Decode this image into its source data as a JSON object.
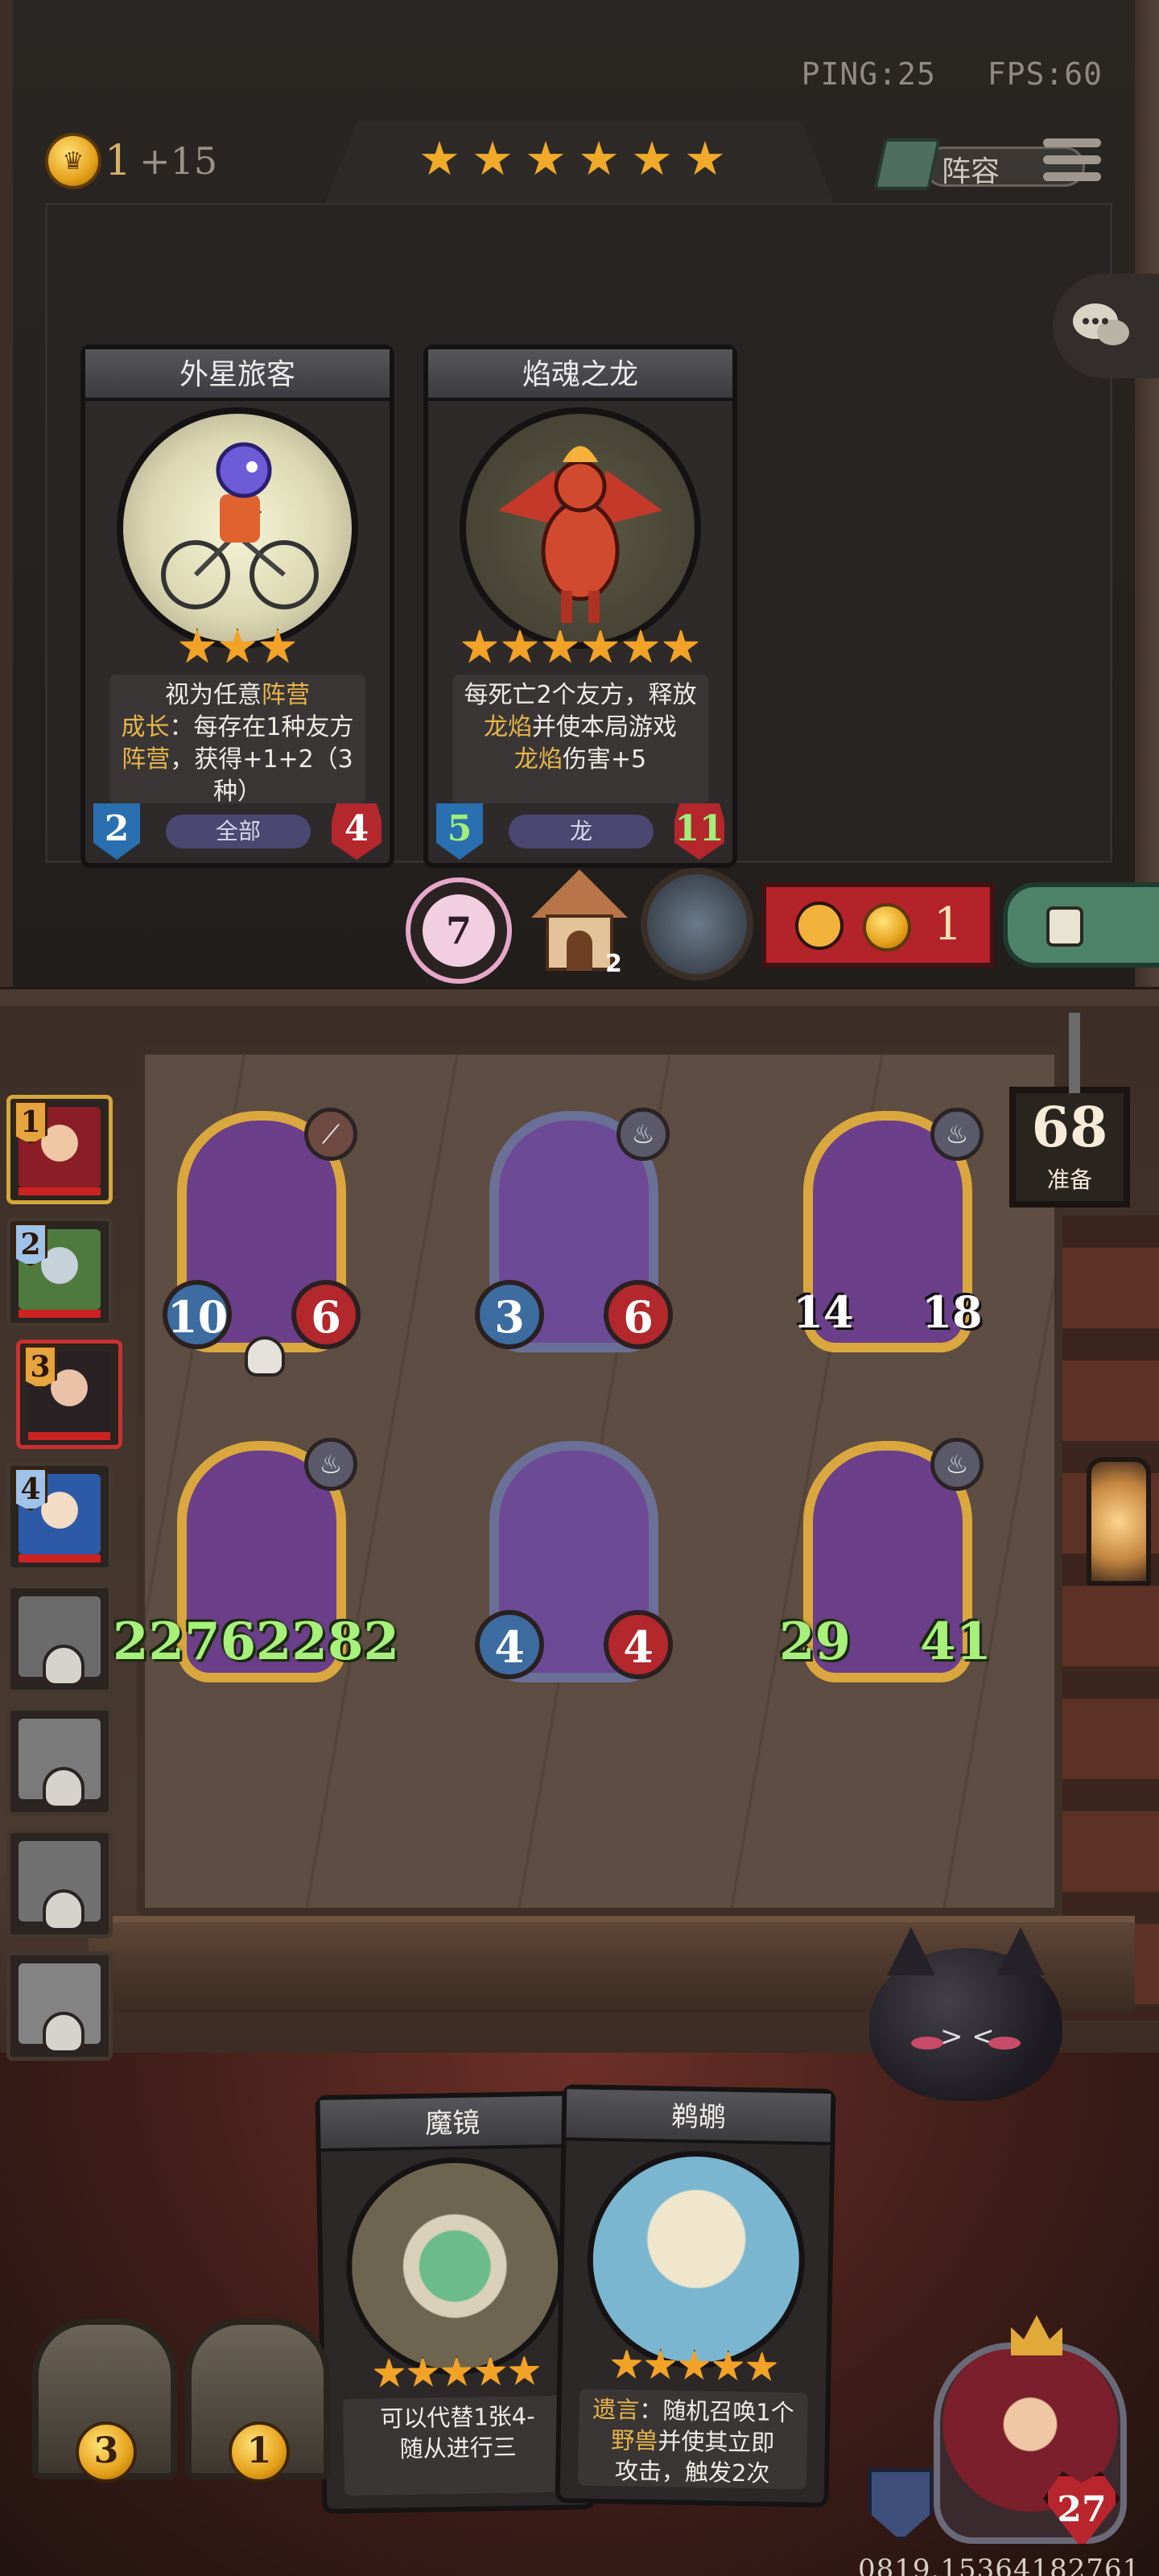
{
  "network": {
    "ping": "PING:25",
    "fps": "FPS:60"
  },
  "gold": {
    "amount": "1",
    "income": "+15"
  },
  "tavern_tier_stars": 6,
  "lineup_button": "阵容",
  "shop_cards": [
    {
      "name": "外星旅客",
      "stars": 3,
      "desc_line1_pre": "视为任意",
      "desc_line1_hl": "阵营",
      "desc_line2_hl": "成长",
      "desc_line2_post": "：每存在1种友方",
      "desc_line3_hl": "阵营",
      "desc_line3_post": "，获得+1+2（3种）",
      "attack": "2",
      "health": "4",
      "tribe": "全部",
      "art": "alien-on-bicycle"
    },
    {
      "name": "焰魂之龙",
      "stars": 6,
      "desc_line1_pre": "每死亡2个友方，释放",
      "desc_line2_hl": "龙焰",
      "desc_line2_post": "并使本局游戏",
      "desc_line3_hl": "龙焰",
      "desc_line3_post": "伤害+5",
      "attack": "5",
      "health": "11",
      "tribe": "龙",
      "art": "red-fire-dragon"
    }
  ],
  "shop_actions": {
    "tavern_level": "7",
    "house_count": "2",
    "refresh_cost": "1"
  },
  "turn_timer": {
    "value": "68",
    "label": "准备"
  },
  "players": [
    {
      "rank": "1",
      "state": "self"
    },
    {
      "rank": "2",
      "state": "alive"
    },
    {
      "rank": "3",
      "state": "current-opponent"
    },
    {
      "rank": "4",
      "state": "alive"
    },
    {
      "rank": "",
      "state": "dead"
    },
    {
      "rank": "",
      "state": "dead"
    },
    {
      "rank": "",
      "state": "dead"
    },
    {
      "rank": "",
      "state": "dead"
    }
  ],
  "board_minions": [
    {
      "name": "pelican",
      "attack": "10",
      "health": "6",
      "frame": "gold",
      "tribe_icon": "claw-icon",
      "deathrattle": true
    },
    {
      "name": "fire-dragon",
      "attack": "3",
      "health": "6",
      "frame": "silver",
      "tribe_icon": "flame-icon",
      "deathrattle": false
    },
    {
      "name": "sea-serpent",
      "attack": "14",
      "health": "18",
      "frame": "gold",
      "tribe_icon": "flame-icon",
      "deathrattle": false
    },
    {
      "name": "golden-dragon",
      "attack": "2276",
      "health": "2282",
      "frame": "gold",
      "tribe_icon": "flame-icon",
      "deathrattle": false
    },
    {
      "name": "clown",
      "attack": "4",
      "health": "4",
      "frame": "silver",
      "tribe_icon": "",
      "deathrattle": false
    },
    {
      "name": "fire-dragon-2",
      "attack": "29",
      "health": "41",
      "frame": "gold",
      "tribe_icon": "flame-icon",
      "deathrattle": false
    }
  ],
  "hand_cards": [
    {
      "name": "魔镜",
      "stars": 5,
      "desc_line1": "可以代替1张4-",
      "desc_line2": "随从进行三"
    },
    {
      "name": "鹈鹕",
      "stars": 5,
      "desc_line1_hl": "遗言",
      "desc_line1_post": "：随机召唤1个",
      "desc_line2_hl": "野兽",
      "desc_line2_post": "并使其立即",
      "desc_line3": "攻击，触发2次"
    }
  ],
  "chests": [
    "3",
    "1"
  ],
  "hero": {
    "health": "27"
  },
  "session_id": "0819.15364182761"
}
